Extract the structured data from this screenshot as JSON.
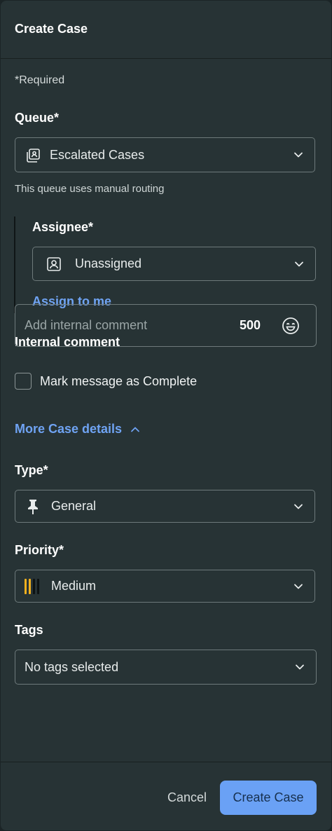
{
  "header": {
    "title": "Create Case"
  },
  "form": {
    "required_note": "*Required",
    "queue": {
      "label": "Queue*",
      "value": "Escalated Cases",
      "icon": "queue-stack-icon",
      "helper": "This queue uses manual routing"
    },
    "assignee": {
      "label": "Assignee*",
      "value": "Unassigned",
      "icon": "person-card-icon",
      "assign_link": "Assign to me"
    },
    "comment": {
      "label": "Internal comment",
      "placeholder": "Add internal comment",
      "counter": "500",
      "icon": "emoji-smile-icon"
    },
    "complete_checkbox": {
      "label": "Mark message as Complete",
      "checked": false
    },
    "more_details": {
      "label": "More Case details",
      "expanded": true
    },
    "type": {
      "label": "Type*",
      "value": "General",
      "icon": "pushpin-icon"
    },
    "priority": {
      "label": "Priority*",
      "value": "Medium",
      "icon": "priority-bars-icon",
      "level": 2,
      "max_level": 4,
      "color": "#f2b01e"
    },
    "tags": {
      "label": "Tags",
      "value": "No tags selected"
    }
  },
  "footer": {
    "cancel_label": "Cancel",
    "create_label": "Create Case"
  },
  "colors": {
    "panel_bg": "#273335",
    "accent": "#6aa1f5",
    "link": "#6fa3f3",
    "border": "#6e7a7b"
  }
}
